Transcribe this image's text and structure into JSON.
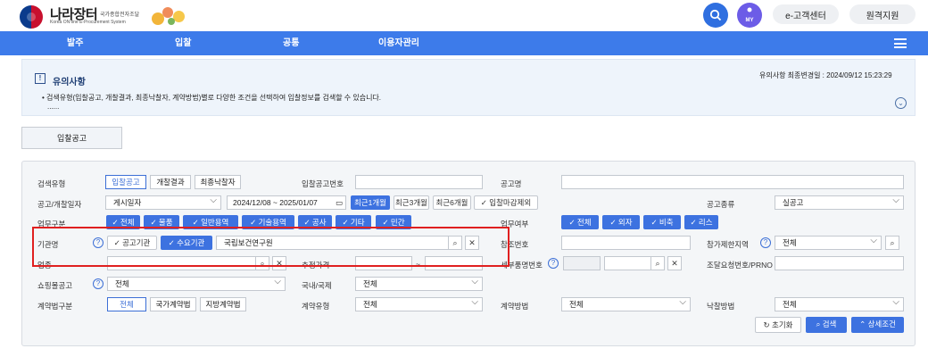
{
  "header": {
    "logo_title": "나라장터",
    "logo_small": "국가종합전자조달",
    "logo_sub": "Korea ON-line E-Procurement System",
    "my_label": "MY",
    "customer_center": "e-고객센터",
    "remote_support": "원격지원"
  },
  "nav": {
    "items": [
      "발주",
      "입찰",
      "공통",
      "이용자관리"
    ]
  },
  "notice": {
    "icon": "!",
    "title": "유의사항",
    "updated": "유의사항 최종변경일 : 2024/09/12 15:23:29",
    "text": "• 검색유형(입찰공고, 개찰결과, 최종낙찰자, 계약방법)별로 다양한 조건을 선택하여 입찰정보를 검색할 수 있습니다.",
    "dots": "......"
  },
  "tab": {
    "label": "입찰공고"
  },
  "form": {
    "search_type": {
      "label": "검색유형",
      "options": [
        "입찰공고",
        "개찰결과",
        "최종낙찰자"
      ]
    },
    "bid_no": {
      "label": "입찰공고번호",
      "value": ""
    },
    "notice_name": {
      "label": "공고명",
      "value": ""
    },
    "date": {
      "label": "공고/개찰일자",
      "type_value": "게시일자",
      "range": "2024/12/08 ~ 2025/01/07",
      "quick": [
        "최근1개월",
        "최근3개월",
        "최근6개월"
      ],
      "exclude_closed": "입찰마감제외"
    },
    "notice_kind": {
      "label": "공고종류",
      "value": "실공고"
    },
    "biz_type": {
      "label": "업무구분",
      "chips": [
        "전체",
        "물품",
        "일반용역",
        "기술용역",
        "공사",
        "기타",
        "민간"
      ]
    },
    "biz_status": {
      "label": "업무여부",
      "chips": [
        "전체",
        "외자",
        "비축",
        "리스"
      ]
    },
    "agency": {
      "label": "기관명",
      "type_options": [
        "공고기관",
        "수요기관"
      ],
      "value": "국립보건연구원"
    },
    "ref_no": {
      "label": "참조번호",
      "value": ""
    },
    "region": {
      "label": "참가제한지역",
      "value": "전체"
    },
    "item": {
      "label": "업종",
      "value": ""
    },
    "est_price": {
      "label": "추정가격",
      "tilde": "~"
    },
    "product_no": {
      "label": "세부품명번호"
    },
    "procure_no": {
      "label": "조달요청번호/PRNO",
      "value": ""
    },
    "mall": {
      "label": "쇼핑몰공고",
      "value": "전체"
    },
    "domestic": {
      "label": "국내/국제",
      "value": "전체"
    },
    "law": {
      "label": "계약법구분",
      "options": [
        "전체",
        "국가계약법",
        "지방계약법"
      ]
    },
    "contract_type": {
      "label": "계약유형",
      "value": "전체"
    },
    "contract_method": {
      "label": "계약방법",
      "value": "전체"
    },
    "award_method": {
      "label": "낙찰방법",
      "value": "전체"
    }
  },
  "actions": {
    "reset": "초기화",
    "search": "검색",
    "detail": "상세조건"
  },
  "colors": {
    "primary": "#3d72e0",
    "nav": "#3d7bea",
    "highlight": "#e02020"
  }
}
